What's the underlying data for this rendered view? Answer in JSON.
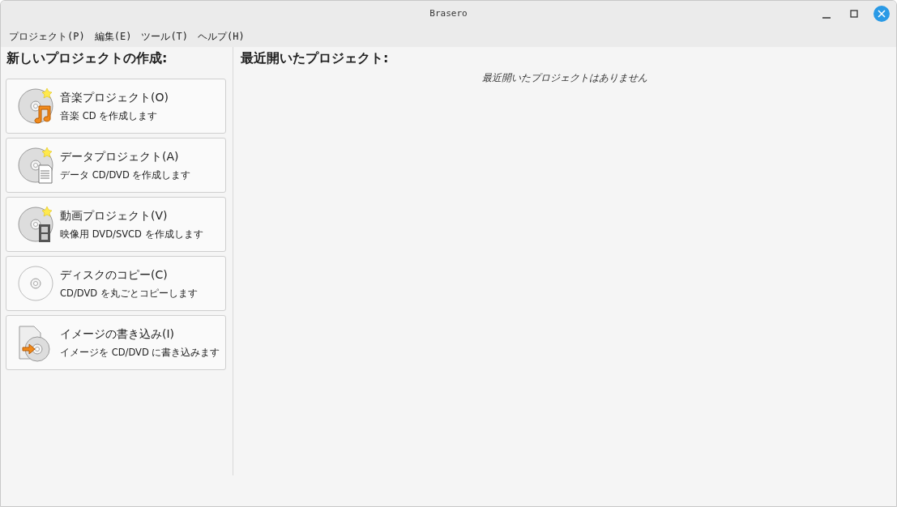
{
  "window": {
    "title": "Brasero"
  },
  "menu": [
    "プロジェクト(P)",
    "編集(E)",
    "ツール(T)",
    "ヘルプ(H)"
  ],
  "new_project": {
    "heading": "新しいプロジェクトの作成:",
    "items": [
      {
        "kind": "audio",
        "title": "音楽プロジェクト(O)",
        "subtitle": "音楽 CD を作成します"
      },
      {
        "kind": "data",
        "title": "データプロジェクト(A)",
        "subtitle": "データ CD/DVD を作成します"
      },
      {
        "kind": "video",
        "title": "動画プロジェクト(V)",
        "subtitle": "映像用 DVD/SVCD を作成します"
      },
      {
        "kind": "copy",
        "title": "ディスクのコピー(C)",
        "subtitle": "CD/DVD を丸ごとコピーします"
      },
      {
        "kind": "image",
        "title": "イメージの書き込み(I)",
        "subtitle": "イメージを CD/DVD に書き込みます"
      }
    ]
  },
  "recent": {
    "heading": "最近開いたプロジェクト:",
    "empty_message": "最近開いたプロジェクトはありません"
  }
}
